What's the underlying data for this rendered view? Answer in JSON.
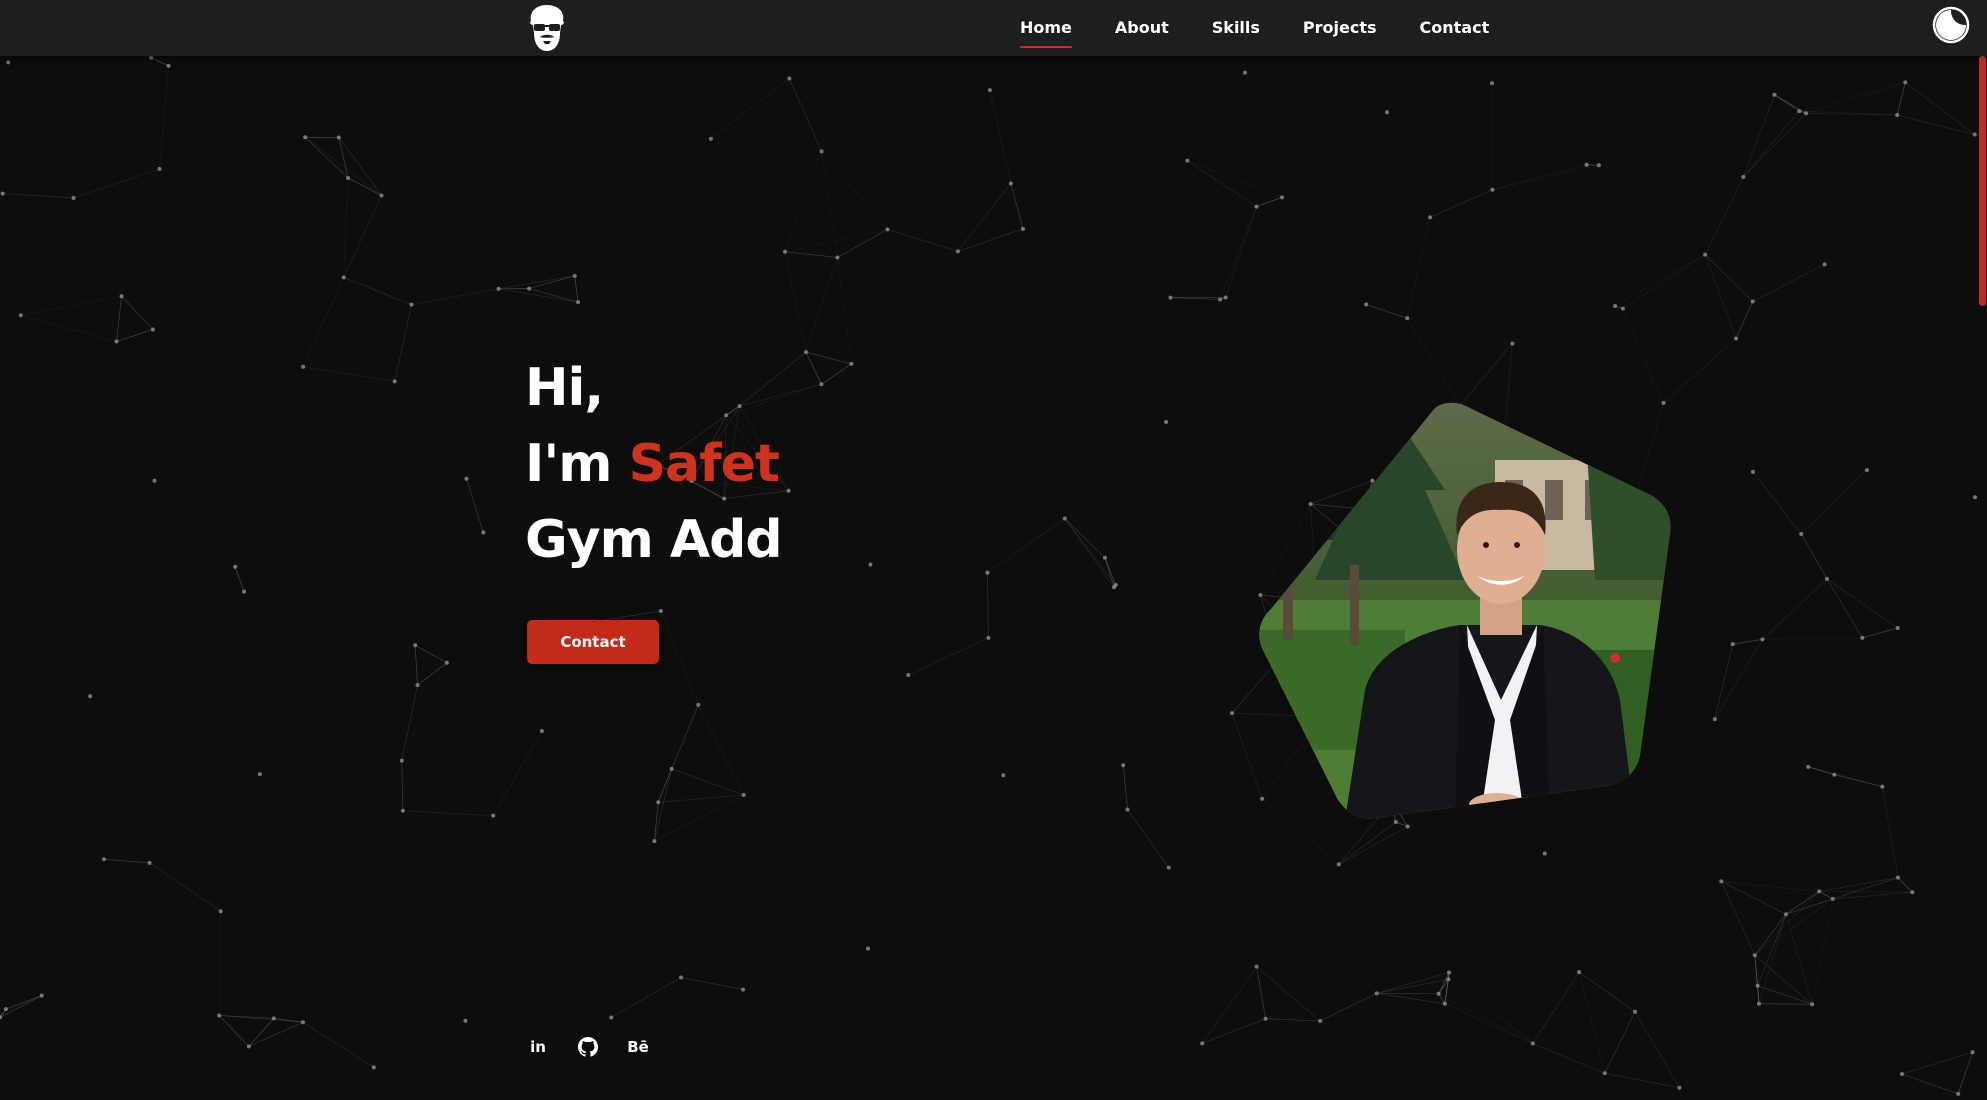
{
  "nav": {
    "items": [
      {
        "label": "Home",
        "active": true
      },
      {
        "label": "About",
        "active": false
      },
      {
        "label": "Skills",
        "active": false
      },
      {
        "label": "Projects",
        "active": false
      },
      {
        "label": "Contact",
        "active": false
      }
    ]
  },
  "icons": {
    "logo": "bearded-face-sunglasses-logo",
    "theme_toggle": "moon-icon",
    "socials": [
      "linkedin-icon",
      "github-icon",
      "behance-icon"
    ]
  },
  "hero": {
    "line1": "Hi,",
    "line2_prefix": "I'm ",
    "line2_name": "Safet",
    "line3": "Gym Add",
    "cta_label": "Contact"
  },
  "socials": {
    "linkedin_label": "in",
    "behance_label": "Bē"
  },
  "colors": {
    "background": "#0d0d0e",
    "navbar": "#1e1e1f",
    "accent": "#c22a1a",
    "accent_text": "#d0321e",
    "text": "#ffffff",
    "particles": "#8a8a8a"
  }
}
